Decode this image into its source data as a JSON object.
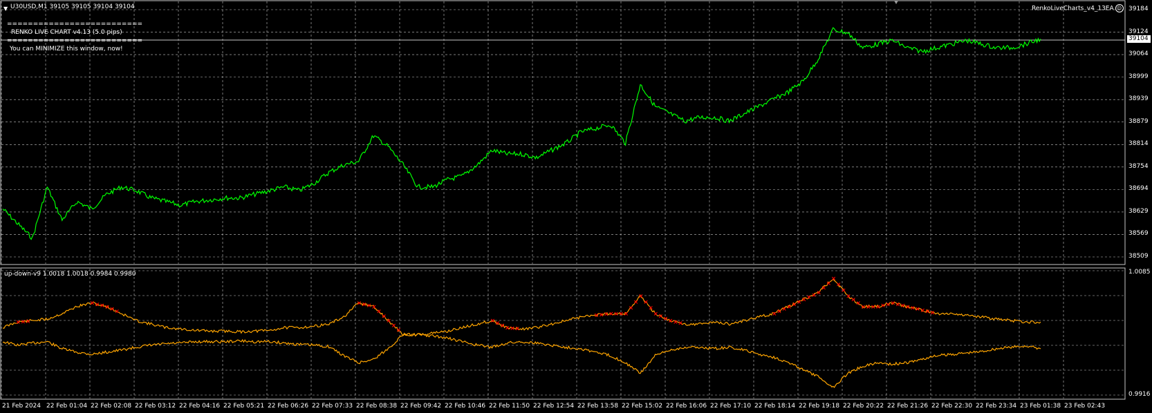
{
  "main_panel": {
    "symbol_header": "U30USD,M1  39105 39105 39104 39104",
    "ea_label": "RenkoLiveCharts_v4_13EA",
    "ea_icon": "smiley-icon",
    "info_lines": [
      "==========================",
      "RENKO LIVE CHART v4.13 (5.0 pips)",
      "==========================",
      "You can MINIMIZE this window, now!"
    ],
    "current_price": "39104",
    "y_ticks": [
      "39184",
      "39124",
      "39064",
      "38999",
      "38939",
      "38879",
      "38814",
      "38754",
      "38694",
      "38629",
      "38569",
      "38509"
    ]
  },
  "sub_panel": {
    "indicator_header": "up-down-v9 1.0018 1.0018 0.9984 0.9980",
    "y_ticks": [
      "1.0085",
      "0.9916"
    ]
  },
  "x_ticks": [
    "21 Feb 2024",
    "22 Feb 01:04",
    "22 Feb 02:08",
    "22 Feb 03:12",
    "22 Feb 04:16",
    "22 Feb 05:21",
    "22 Feb 06:26",
    "22 Feb 07:33",
    "22 Feb 08:38",
    "22 Feb 09:42",
    "22 Feb 10:46",
    "22 Feb 11:50",
    "22 Feb 12:54",
    "22 Feb 13:58",
    "22 Feb 15:02",
    "22 Feb 16:06",
    "22 Feb 17:10",
    "22 Feb 18:14",
    "22 Feb 19:18",
    "22 Feb 20:22",
    "22 Feb 21:26",
    "22 Feb 22:30",
    "22 Feb 23:34",
    "23 Feb 01:38",
    "23 Feb 02:43"
  ],
  "colors": {
    "background": "#000000",
    "price_line": "#00ff00",
    "indicator_line": "#ffa500",
    "signal_marker": "#ff0000",
    "grid": "#c8c8c8"
  },
  "chart_data": [
    {
      "type": "line",
      "series": [
        {
          "values": [
            38640,
            38600,
            38560,
            38700,
            38610,
            38660,
            38640,
            38680,
            38700,
            38690,
            38670,
            38660,
            38650,
            38660,
            38665,
            38670,
            38670,
            38680,
            38690,
            38700,
            38690,
            38710,
            38740,
            38760,
            38770,
            38840,
            38810,
            38760,
            38700,
            38700,
            38720,
            38730,
            38760,
            38800,
            38790,
            38790,
            38780,
            38800,
            38820,
            38850,
            38860,
            38870,
            38820,
            38980,
            38920,
            38900,
            38880,
            38890,
            38890,
            38880,
            38900,
            38920,
            38940,
            38960,
            38990,
            39050,
            39130,
            39120,
            39080,
            39090,
            39100,
            39080,
            39070,
            39080,
            39090,
            39100,
            39090,
            39080,
            39080,
            39090,
            39104
          ]
        }
      ],
      "ylim": [
        38509,
        39184
      ]
    },
    {
      "type": "line",
      "series": [
        {
          "values": [
            1.001,
            1.0018,
            1.002,
            1.0022,
            1.003,
            1.004,
            1.0045,
            1.004,
            1.003,
            1.002,
            1.0015,
            1.001,
            1.0008,
            1.0006,
            1.0005,
            1.0005,
            1.0004,
            1.0005,
            1.0006,
            1.001,
            1.001,
            1.0012,
            1.0015,
            1.0025,
            1.0045,
            1.004,
            1.002,
            1.0,
            1.0,
            1.0002,
            1.0005,
            1.001,
            1.0015,
            1.002,
            1.001,
            1.0008,
            1.001,
            1.0015,
            1.002,
            1.0025,
            1.0028,
            1.003,
            1.003,
            1.0055,
            1.003,
            1.002,
            1.0015,
            1.0015,
            1.0018,
            1.0015,
            1.002,
            1.0025,
            1.003,
            1.004,
            1.005,
            1.006,
            1.008,
            1.0055,
            1.004,
            1.004,
            1.0045,
            1.004,
            1.0035,
            1.003,
            1.003,
            1.0028,
            1.0025,
            1.0022,
            1.002,
            1.0018,
            1.0018
          ]
        },
        {
          "values": [
            0.999,
            0.9985,
            0.9988,
            0.999,
            0.998,
            0.9975,
            0.9972,
            0.9975,
            0.9978,
            0.9982,
            0.9985,
            0.9987,
            0.9988,
            0.999,
            0.999,
            0.999,
            0.9991,
            0.999,
            0.999,
            0.9988,
            0.9986,
            0.9985,
            0.9983,
            0.997,
            0.996,
            0.9965,
            0.998,
            1.0,
            1.0,
            0.9998,
            0.9995,
            0.999,
            0.9985,
            0.9982,
            0.9988,
            0.999,
            0.9988,
            0.9985,
            0.9982,
            0.998,
            0.9975,
            0.997,
            0.996,
            0.9945,
            0.997,
            0.9978,
            0.9982,
            0.9982,
            0.998,
            0.9982,
            0.9978,
            0.9972,
            0.9968,
            0.996,
            0.995,
            0.994,
            0.9925,
            0.9945,
            0.9955,
            0.996,
            0.9958,
            0.996,
            0.9965,
            0.997,
            0.9972,
            0.9974,
            0.9976,
            0.998,
            0.9982,
            0.9984,
            0.998
          ]
        }
      ],
      "signal_indices": [
        1,
        6,
        7,
        24,
        25,
        26,
        33,
        34,
        40,
        41,
        42,
        43,
        44,
        45,
        52,
        53,
        54,
        55,
        56,
        57,
        58,
        59,
        60,
        61,
        62
      ],
      "ylim": [
        0.9916,
        1.0085
      ]
    }
  ]
}
